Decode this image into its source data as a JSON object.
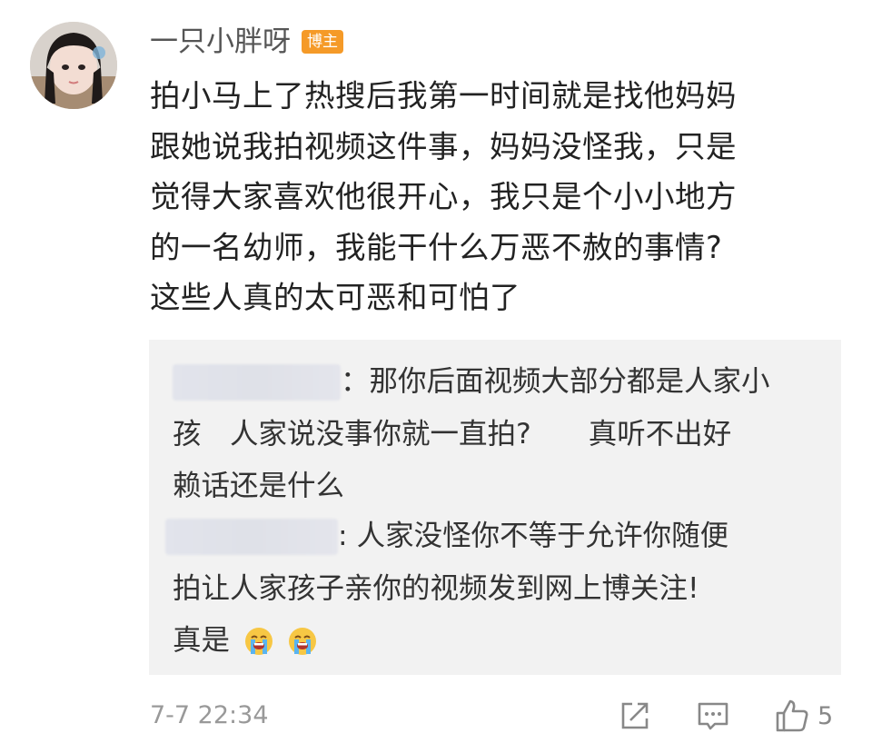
{
  "post": {
    "username": "一只小胖呀",
    "badge": "博主",
    "text_lines": [
      "拍小马上了热搜后我第一时间就是找他妈妈",
      "跟她说我拍视频这件事，妈妈没怪我，只是",
      "觉得大家喜欢他很开心，我只是个小小地方",
      "的一名幼师，我能干什么万恶不赦的事情?",
      "这些人真的太可恶和可怕了"
    ]
  },
  "replies": [
    {
      "line1": "：那你后面视频大部分都是人家小",
      "line2": "孩　人家说没事你就一直拍?　　真听不出好",
      "line3": "赖话还是什么"
    },
    {
      "line1": ": 人家没怪你不等于允许你随便",
      "line2": "拍让人家孩子亲你的视频发到网上博关注!",
      "line3": "真是",
      "emojis": [
        "crying-face-emoji",
        "crying-face-emoji"
      ]
    }
  ],
  "footer": {
    "timestamp": "7-7 22:34",
    "like_count": "5",
    "icons": [
      "share-icon",
      "comment-icon",
      "like-icon"
    ]
  }
}
